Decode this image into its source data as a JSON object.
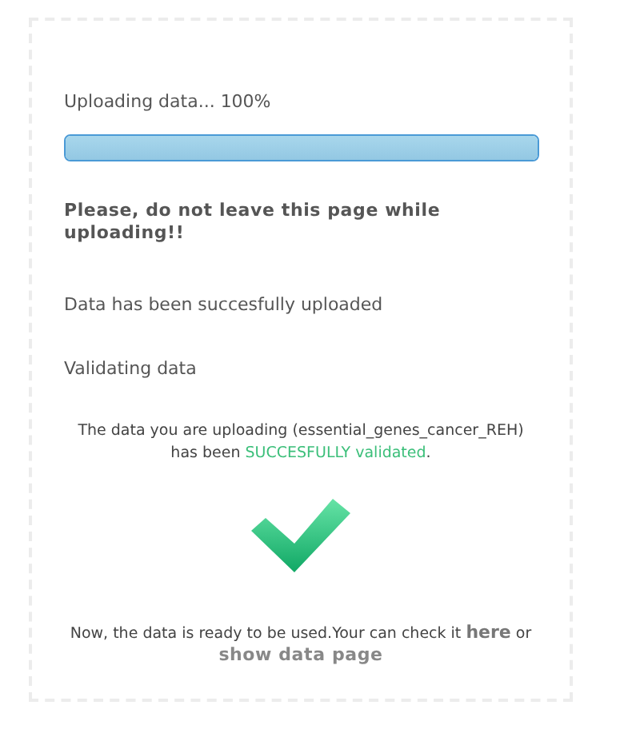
{
  "progress": {
    "label": "Uploading data... 100%",
    "level": 1
  },
  "warning": "Please, do not leave this page while uploading!!",
  "steps": [
    "Data has been succesfully uploaded",
    "Validating data"
  ],
  "validation": {
    "before": "The data you are uploading (essential_genes_cancer_REH) has been",
    "success": "SUCCESFULLY validated",
    "after": "."
  },
  "ready": {
    "before": "Now, the data is ready to be used.Your can check it",
    "link_here": "here",
    "middle": "or",
    "link_show": "show data page"
  }
}
